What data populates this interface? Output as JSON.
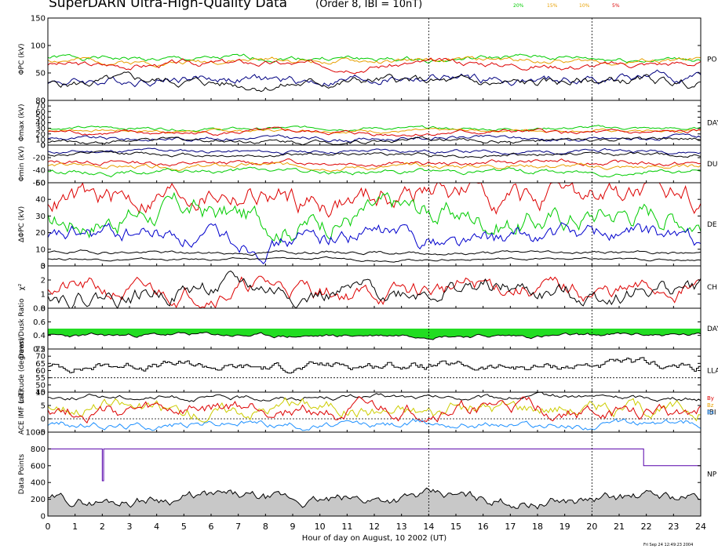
{
  "header": {
    "title": "SuperDARN Ultra-High-Quality Data",
    "subtitle": "(Order 8, IBI = 10nT)",
    "thresholds": [
      {
        "label": "20%",
        "color": "#00cc00"
      },
      {
        "label": "15%",
        "color": "#e8a000"
      },
      {
        "label": "10%",
        "color": "#e8a000"
      },
      {
        "label": "5%",
        "color": "#dd0000"
      }
    ]
  },
  "footer": {
    "timestamp": "Fri Sep 24 12:49:23 2004"
  },
  "chart_data": {
    "type": "line",
    "xlabel": "Hour of day on August, 10 2002 (UT)",
    "xlim": [
      0,
      24
    ],
    "x_ticks": [
      "0",
      "1",
      "2",
      "3",
      "4",
      "5",
      "6",
      "7",
      "8",
      "9",
      "10",
      "11",
      "12",
      "13",
      "14",
      "15",
      "16",
      "17",
      "18",
      "19",
      "20",
      "21",
      "22",
      "23",
      "24"
    ],
    "vertical_markers": [
      14,
      20
    ],
    "panels": [
      {
        "key": "pc",
        "ylabel": "ΦPC (kV)",
        "ylim": [
          0,
          150
        ],
        "yticks": [
          "0",
          "50",
          "100",
          "150"
        ],
        "right_label": "PO",
        "series": [
          {
            "color": "#00cc00",
            "level": 76,
            "amp": 5,
            "seed": 1
          },
          {
            "color": "#e8a000",
            "level": 72,
            "amp": 5,
            "seed": 2
          },
          {
            "color": "#dd0000",
            "level": 66,
            "amp": 6,
            "seed": 3
          },
          {
            "color": "#000080",
            "level": 38,
            "amp": 9,
            "seed": 4
          },
          {
            "color": "#000000",
            "level": 32,
            "amp": 9,
            "seed": 5
          }
        ]
      },
      {
        "key": "max",
        "ylabel": "Φmax (kV)",
        "ylim": [
          0,
          80
        ],
        "yticks": [
          "0",
          "10",
          "20",
          "30",
          "40",
          "50",
          "60",
          "70",
          "80"
        ],
        "right_label": "DAY",
        "series": [
          {
            "color": "#00cc00",
            "level": 30,
            "amp": 3,
            "seed": 6
          },
          {
            "color": "#e8a000",
            "level": 26,
            "amp": 3,
            "seed": 7
          },
          {
            "color": "#dd0000",
            "level": 22,
            "amp": 4,
            "seed": 8
          },
          {
            "color": "#000080",
            "level": 12,
            "amp": 4,
            "seed": 9
          },
          {
            "color": "#000000",
            "level": 8,
            "amp": 4,
            "seed": 10
          }
        ]
      },
      {
        "key": "min",
        "ylabel": "Φmin (kV)",
        "ylim": [
          -60,
          0
        ],
        "yticks": [
          "-60",
          "-40",
          "-20",
          "0"
        ],
        "right_label": "DU",
        "series": [
          {
            "color": "#000080",
            "level": -10,
            "amp": 3,
            "seed": 11
          },
          {
            "color": "#000000",
            "level": -15,
            "amp": 3,
            "seed": 12
          },
          {
            "color": "#dd0000",
            "level": -28,
            "amp": 4,
            "seed": 13
          },
          {
            "color": "#e8a000",
            "level": -34,
            "amp": 4,
            "seed": 14
          },
          {
            "color": "#00cc00",
            "level": -42,
            "amp": 4,
            "seed": 15
          }
        ]
      },
      {
        "key": "dpc",
        "ylabel": "ΔΦPC (kV)",
        "ylim": [
          0,
          50
        ],
        "yticks": [
          "0",
          "10",
          "20",
          "30",
          "40",
          "50"
        ],
        "right_label": "DE",
        "series": [
          {
            "color": "#dd0000",
            "level": 42,
            "amp": 8,
            "seed": 16
          },
          {
            "color": "#00cc00",
            "level": 30,
            "amp": 8,
            "seed": 17
          },
          {
            "color": "#0000cc",
            "level": 17,
            "amp": 6,
            "seed": 18
          },
          {
            "color": "#000000",
            "level": 8,
            "amp": 1,
            "seed": 19
          },
          {
            "color": "#000000",
            "level": 4,
            "amp": 0.7,
            "seed": 20
          }
        ]
      },
      {
        "key": "chi",
        "ylabel": "χ²",
        "ylim": [
          0,
          3
        ],
        "yticks": [
          "0",
          "1",
          "2",
          "3"
        ],
        "right_label": "CH",
        "series": [
          {
            "color": "#dd0000",
            "level": 1.3,
            "amp": 0.7,
            "seed": 21
          },
          {
            "color": "#000000",
            "level": 1.2,
            "amp": 0.7,
            "seed": 22
          }
        ]
      },
      {
        "key": "ratio",
        "ylabel": "Dawn/Dusk Ratio",
        "ylim": [
          0.2,
          0.8
        ],
        "yticks": [
          "0.2",
          "0.4",
          "0.6",
          "0.8"
        ],
        "right_label": "DAY",
        "fill_color": "#22dd22",
        "series": [
          {
            "color": "#000000",
            "level": 0.4,
            "amp": 0.03,
            "seed": 23
          }
        ]
      },
      {
        "key": "lat",
        "ylabel": "Latitude (degrees)",
        "ylim": [
          45,
          75
        ],
        "yticks": [
          "45",
          "50",
          "55",
          "60",
          "65",
          "70",
          "75"
        ],
        "right_label": "LLA",
        "dashed_level": 55,
        "series": [
          {
            "color": "#000000",
            "level": 63,
            "amp": 3,
            "seed": 24,
            "step": true
          }
        ]
      },
      {
        "key": "imf",
        "ylabel": "ACE IMF (nT)",
        "ylim": [
          -5,
          10
        ],
        "yticks": [
          "-5",
          "0",
          "5",
          "10"
        ],
        "right_label": "IBI",
        "dashed_level": 0,
        "legend": [
          {
            "label": "By",
            "color": "#dd0000"
          },
          {
            "label": "Bz",
            "color": "#e8a000"
          },
          {
            "label": "Bx",
            "color": "#1e90ff"
          }
        ],
        "series": [
          {
            "color": "#000000",
            "level": 8,
            "amp": 1,
            "seed": 25
          },
          {
            "color": "#cccc00",
            "level": 4,
            "amp": 3,
            "seed": 26
          },
          {
            "color": "#dd0000",
            "level": 3,
            "amp": 3,
            "seed": 27
          },
          {
            "color": "#1e90ff",
            "level": -2,
            "amp": 1.5,
            "seed": 28
          }
        ]
      },
      {
        "key": "pts",
        "ylabel": "Data Points",
        "ylim": [
          0,
          1000
        ],
        "yticks": [
          "0",
          "200",
          "400",
          "600",
          "800",
          "1000"
        ],
        "right_label": "NP",
        "npoints": {
          "color": "#5500aa",
          "segments": [
            [
              0,
              2.0,
              800
            ],
            [
              2.0,
              2.05,
              420
            ],
            [
              2.05,
              21.9,
              800
            ],
            [
              21.9,
              24,
              600
            ]
          ]
        },
        "fill_color": "#c8c8c8",
        "series": [
          {
            "color": "#000000",
            "level": 200,
            "amp": 70,
            "seed": 29
          }
        ]
      }
    ]
  }
}
